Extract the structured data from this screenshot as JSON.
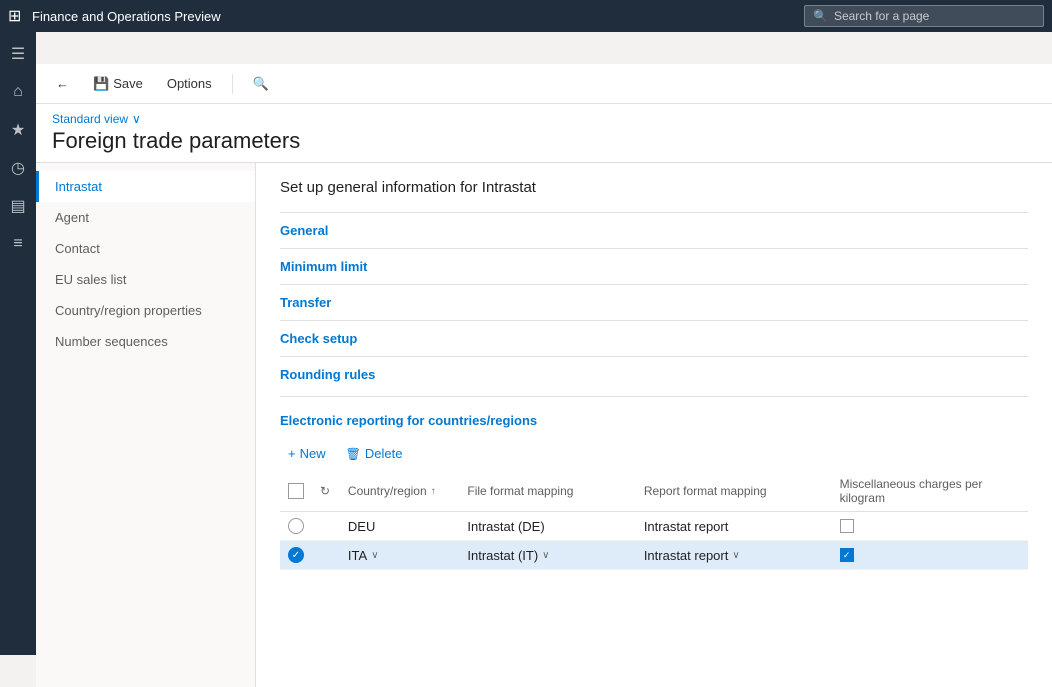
{
  "app": {
    "title": "Finance and Operations Preview",
    "search_placeholder": "Search for a page"
  },
  "toolbar": {
    "back_label": "",
    "save_label": "Save",
    "options_label": "Options",
    "search_label": ""
  },
  "page": {
    "standard_view_label": "Standard view",
    "title": "Foreign trade parameters",
    "section_intro": "Set up general information for Intrastat"
  },
  "left_nav": {
    "items": [
      {
        "id": "intrastat",
        "label": "Intrastat",
        "active": true
      },
      {
        "id": "agent",
        "label": "Agent",
        "active": false
      },
      {
        "id": "contact",
        "label": "Contact",
        "active": false
      },
      {
        "id": "eu-sales-list",
        "label": "EU sales list",
        "active": false
      },
      {
        "id": "country-region",
        "label": "Country/region properties",
        "active": false
      },
      {
        "id": "number-sequences",
        "label": "Number sequences",
        "active": false
      }
    ]
  },
  "sections": [
    {
      "id": "general",
      "label": "General"
    },
    {
      "id": "minimum-limit",
      "label": "Minimum limit"
    },
    {
      "id": "transfer",
      "label": "Transfer"
    },
    {
      "id": "check-setup",
      "label": "Check setup"
    },
    {
      "id": "rounding-rules",
      "label": "Rounding rules"
    }
  ],
  "electronic_reporting": {
    "title": "Electronic reporting for countries/regions",
    "new_label": "New",
    "delete_label": "Delete",
    "columns": [
      {
        "id": "country-region",
        "label": "Country/region",
        "sortable": true
      },
      {
        "id": "file-format-mapping",
        "label": "File format mapping"
      },
      {
        "id": "report-format-mapping",
        "label": "Report format mapping"
      },
      {
        "id": "misc-charges",
        "label": "Miscellaneous charges per kilogram"
      }
    ],
    "rows": [
      {
        "id": "row-deu",
        "selected": false,
        "editing": false,
        "country": "DEU",
        "file_format": "Intrastat (DE)",
        "report_format": "Intrastat report",
        "misc_checked": false
      },
      {
        "id": "row-ita",
        "selected": true,
        "editing": true,
        "country": "ITA",
        "file_format": "Intrastat (IT)",
        "report_format": "Intrastat report",
        "misc_checked": true
      }
    ]
  },
  "icons": {
    "grid": "⊞",
    "home": "⌂",
    "star": "★",
    "clock": "◷",
    "layers": "▤",
    "list": "≡",
    "back": "←",
    "save": "💾",
    "search": "🔍",
    "chevron_down": "∨",
    "new_plus": "+",
    "delete_trash": "🗑",
    "sort_up": "↑",
    "dropdown": "∨",
    "check": "✓",
    "refresh": "↻",
    "circle_check": "✓"
  }
}
